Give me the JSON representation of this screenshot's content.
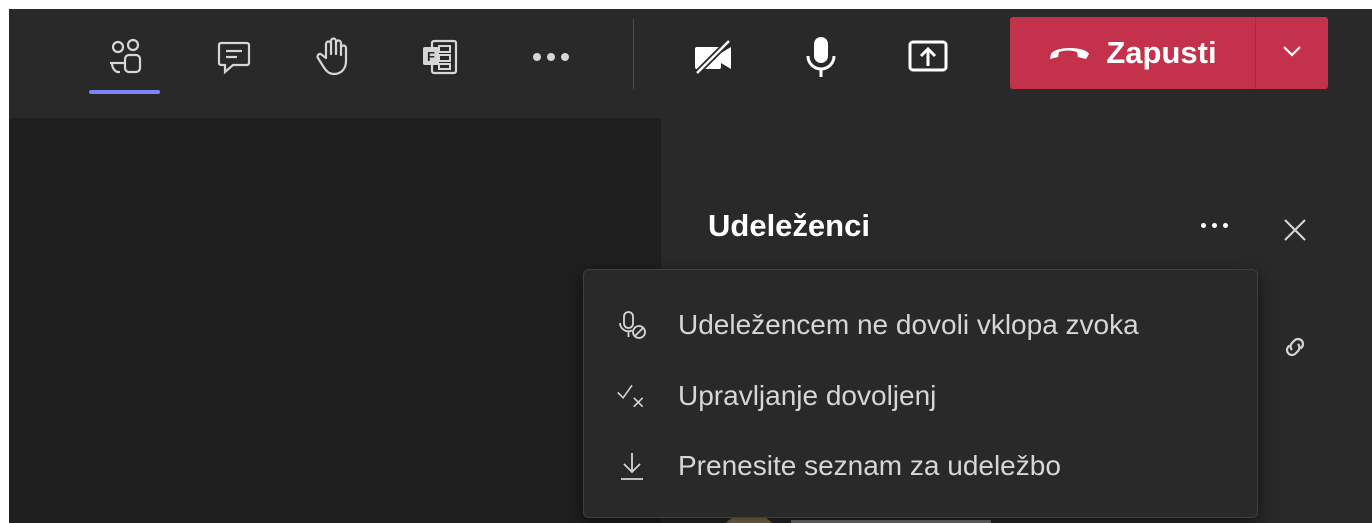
{
  "toolbar": {
    "icons": [
      "people-icon",
      "chat-icon",
      "raise-hand-icon",
      "apps-icon",
      "more-icon",
      "camera-off-icon",
      "microphone-icon",
      "share-screen-icon"
    ],
    "leave_label": "Zapusti",
    "accent": "#7f85f5",
    "leave_color": "#c4314b"
  },
  "panel": {
    "title": "Udeleženci"
  },
  "menu": {
    "items": [
      {
        "label": "Udeležencem ne dovoli vklopa zvoka",
        "icon": "mic-off-icon"
      },
      {
        "label": "Upravljanje dovoljenj",
        "icon": "check-x-icon"
      },
      {
        "label": "Prenesite seznam za udeležbo",
        "icon": "download-icon"
      }
    ]
  }
}
